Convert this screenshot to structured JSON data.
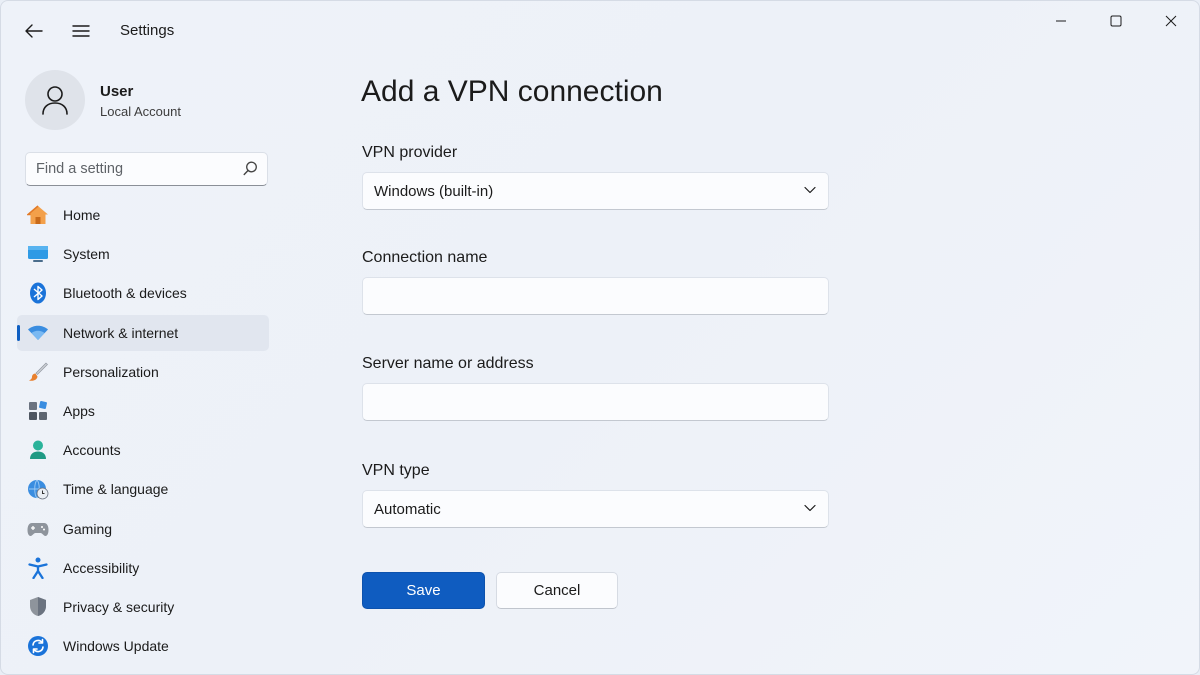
{
  "window": {
    "title": "Settings"
  },
  "titlebar": {
    "back_icon": "back-arrow-icon",
    "menu_icon": "hamburger-menu-icon",
    "controls": [
      "minimize-icon",
      "maximize-icon",
      "close-icon"
    ]
  },
  "profile": {
    "name": "User",
    "account_type": "Local Account"
  },
  "search": {
    "placeholder": "Find a setting",
    "value": ""
  },
  "sidebar": {
    "active_index": 3,
    "items": [
      {
        "label": "Home",
        "icon": "home-icon"
      },
      {
        "label": "System",
        "icon": "system-monitor-icon"
      },
      {
        "label": "Bluetooth & devices",
        "icon": "bluetooth-icon"
      },
      {
        "label": "Network & internet",
        "icon": "wifi-icon"
      },
      {
        "label": "Personalization",
        "icon": "paintbrush-icon"
      },
      {
        "label": "Apps",
        "icon": "apps-icon"
      },
      {
        "label": "Accounts",
        "icon": "person-icon"
      },
      {
        "label": "Time & language",
        "icon": "globe-clock-icon"
      },
      {
        "label": "Gaming",
        "icon": "gamepad-icon"
      },
      {
        "label": "Accessibility",
        "icon": "accessibility-icon"
      },
      {
        "label": "Privacy & security",
        "icon": "shield-icon"
      },
      {
        "label": "Windows Update",
        "icon": "update-icon"
      }
    ]
  },
  "main": {
    "title": "Add a VPN connection",
    "vpn_provider": {
      "label": "VPN provider",
      "value": "Windows (built-in)"
    },
    "connection_name": {
      "label": "Connection name",
      "value": ""
    },
    "server_address": {
      "label": "Server name or address",
      "value": ""
    },
    "vpn_type": {
      "label": "VPN type",
      "value": "Automatic"
    },
    "save_label": "Save",
    "cancel_label": "Cancel"
  },
  "colors": {
    "accent": "#0f5cc0",
    "window_bg": "#eef2f9",
    "active_nav_bg": "#e1e6ef"
  }
}
